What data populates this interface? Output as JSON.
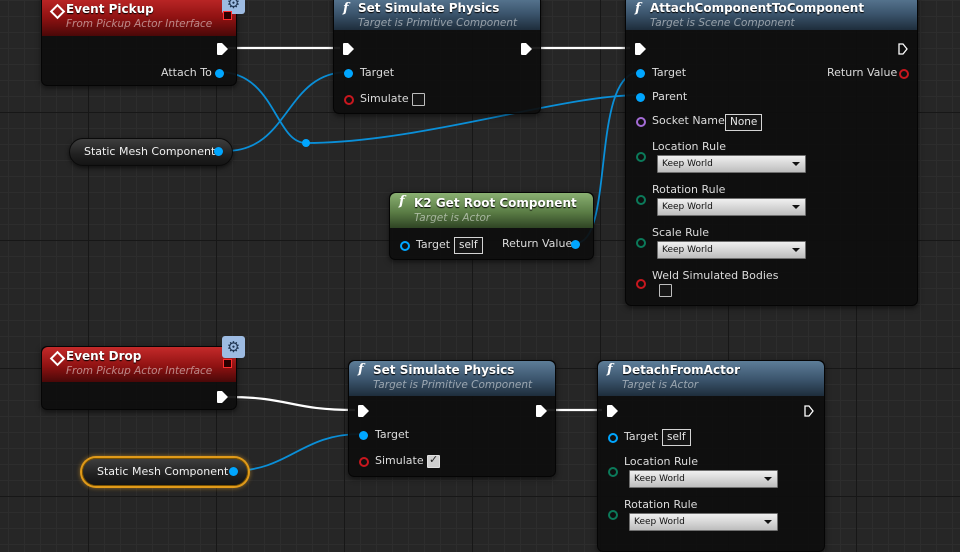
{
  "graph": {
    "event_pickup": {
      "title": "Event Pickup",
      "subtitle": "From Pickup Actor Interface",
      "pin_attach_to": "Attach To"
    },
    "set_sim_1": {
      "title": "Set Simulate Physics",
      "subtitle": "Target is Primitive Component",
      "pin_target": "Target",
      "pin_simulate": "Simulate",
      "simulate_checked": false
    },
    "attach": {
      "title": "AttachComponentToComponent",
      "subtitle": "Target is Scene Component",
      "pin_target": "Target",
      "pin_return": "Return Value",
      "pin_parent": "Parent",
      "pin_socket": "Socket Name",
      "socket_value": "None",
      "pin_location_rule": "Location Rule",
      "location_rule_value": "Keep World",
      "pin_rotation_rule": "Rotation Rule",
      "rotation_rule_value": "Keep World",
      "pin_scale_rule": "Scale Rule",
      "scale_rule_value": "Keep World",
      "pin_weld": "Weld Simulated Bodies",
      "weld_checked": false
    },
    "var_mesh_1": {
      "label": "Static Mesh Component"
    },
    "get_root": {
      "title": "K2 Get Root Component",
      "subtitle": "Target is Actor",
      "pin_target": "Target",
      "self_value": "self",
      "pin_return": "Return Value"
    },
    "event_drop": {
      "title": "Event Drop",
      "subtitle": "From Pickup Actor Interface"
    },
    "set_sim_2": {
      "title": "Set Simulate Physics",
      "subtitle": "Target is Primitive Component",
      "pin_target": "Target",
      "pin_simulate": "Simulate",
      "simulate_checked": true
    },
    "detach": {
      "title": "DetachFromActor",
      "subtitle": "Target is Actor",
      "pin_target": "Target",
      "self_value": "self",
      "pin_location_rule": "Location Rule",
      "location_rule_value": "Keep World",
      "pin_rotation_rule": "Rotation Rule",
      "rotation_rule_value": "Keep World"
    },
    "var_mesh_2": {
      "label": "Static Mesh Component"
    }
  },
  "colors": {
    "object_pin": "#00a6ff",
    "bool_pin": "#c8171e",
    "name_pin": "#a46cd6",
    "event_header": "#9b1616",
    "function_header": "#3e5870",
    "pure_header": "#5e8248",
    "selection": "#e09a1a"
  },
  "icons": {
    "event": "diamond-icon",
    "function": "function-icon",
    "interface_badge": "interface-badge-icon"
  }
}
